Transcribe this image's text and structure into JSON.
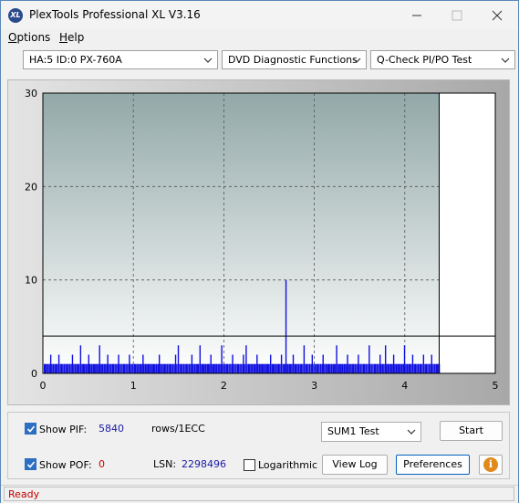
{
  "window": {
    "title": "PlexTools Professional XL V3.16",
    "app_icon_text": "XL"
  },
  "menu": {
    "items": [
      "Options",
      "Help"
    ]
  },
  "selectors": {
    "drive": "HA:5 ID:0  PX-760A",
    "function_group": "DVD Diagnostic Functions",
    "test": "Q-Check PI/PO Test"
  },
  "chart_data": {
    "type": "bar",
    "xlim": [
      0,
      5
    ],
    "ylim": [
      0,
      30
    ],
    "x_ticks": [
      "0",
      "1",
      "2",
      "3",
      "4",
      "5"
    ],
    "y_ticks": [
      "0",
      "10",
      "20",
      "30"
    ],
    "grid": true,
    "data_end_x": 4.38,
    "threshold_line": 4,
    "series": [
      {
        "color": "#1010e0",
        "description": "PI errors per position (approx. sample)",
        "x": [
          0.02,
          0.05,
          0.08,
          0.11,
          0.14,
          0.17,
          0.2,
          0.23,
          0.26,
          0.29,
          0.32,
          0.35,
          0.38,
          0.41,
          0.44,
          0.47,
          0.5,
          0.53,
          0.56,
          0.59,
          0.62,
          0.65,
          0.68,
          0.71,
          0.74,
          0.77,
          0.8,
          0.83,
          0.86,
          0.89,
          0.92,
          0.95,
          0.98,
          1.01,
          1.04,
          1.07,
          1.1,
          1.13,
          1.16,
          1.19,
          1.22,
          1.25,
          1.28,
          1.31,
          1.34,
          1.37,
          1.4,
          1.43,
          1.46,
          1.49,
          1.52,
          1.55,
          1.58,
          1.61,
          1.64,
          1.67,
          1.7,
          1.73,
          1.76,
          1.79,
          1.82,
          1.85,
          1.88,
          1.91,
          1.94,
          1.97,
          2.0,
          2.03,
          2.06,
          2.09,
          2.12,
          2.15,
          2.18,
          2.21,
          2.24,
          2.27,
          2.3,
          2.33,
          2.36,
          2.39,
          2.42,
          2.45,
          2.48,
          2.51,
          2.54,
          2.57,
          2.6,
          2.63,
          2.66,
          2.68,
          2.7,
          2.73,
          2.76,
          2.79,
          2.82,
          2.85,
          2.88,
          2.91,
          2.94,
          2.97,
          3.0,
          3.03,
          3.06,
          3.09,
          3.12,
          3.15,
          3.18,
          3.21,
          3.24,
          3.27,
          3.3,
          3.33,
          3.36,
          3.39,
          3.42,
          3.45,
          3.48,
          3.51,
          3.54,
          3.57,
          3.6,
          3.63,
          3.66,
          3.69,
          3.72,
          3.75,
          3.78,
          3.81,
          3.84,
          3.87,
          3.9,
          3.93,
          3.96,
          3.99,
          4.02,
          4.05,
          4.08,
          4.11,
          4.14,
          4.17,
          4.2,
          4.23,
          4.26,
          4.29,
          4.32,
          4.35
        ],
        "values": [
          1,
          1,
          2,
          1,
          1,
          2,
          1,
          1,
          1,
          1,
          2,
          1,
          1,
          3,
          1,
          1,
          2,
          1,
          1,
          1,
          3,
          1,
          1,
          2,
          1,
          1,
          1,
          2,
          1,
          1,
          1,
          2,
          1,
          1,
          1,
          1,
          2,
          1,
          1,
          1,
          1,
          1,
          2,
          1,
          1,
          1,
          1,
          1,
          2,
          3,
          1,
          1,
          1,
          1,
          2,
          1,
          1,
          3,
          1,
          1,
          1,
          2,
          1,
          1,
          1,
          3,
          1,
          1,
          1,
          2,
          1,
          1,
          1,
          2,
          3,
          1,
          1,
          1,
          2,
          1,
          1,
          1,
          1,
          2,
          1,
          1,
          1,
          2,
          1,
          10,
          1,
          1,
          2,
          1,
          1,
          1,
          3,
          1,
          1,
          2,
          1,
          1,
          1,
          2,
          1,
          1,
          1,
          1,
          3,
          1,
          1,
          1,
          2,
          1,
          1,
          1,
          2,
          1,
          1,
          1,
          3,
          1,
          1,
          1,
          2,
          1,
          3,
          1,
          1,
          2,
          1,
          1,
          1,
          3,
          1,
          1,
          2,
          1,
          1,
          1,
          2,
          1,
          1,
          2,
          1,
          1
        ]
      }
    ]
  },
  "controls": {
    "show_pif_label": "Show PIF:",
    "show_pif_checked": true,
    "pif_value": "5840",
    "pif_unit": "rows/1ECC",
    "show_pof_label": "Show POF:",
    "show_pof_checked": true,
    "pof_value": "0",
    "lsn_label": "LSN:",
    "lsn_value": "2298496",
    "logarithmic_label": "Logarithmic",
    "logarithmic_checked": false,
    "sum_test_selected": "SUM1 Test",
    "start_button": "Start",
    "view_log_button": "View Log",
    "preferences_button": "Preferences",
    "info_glyph": "i"
  },
  "status": {
    "text": "Ready"
  },
  "colors": {
    "bar": "#1010e0",
    "plot_bg_top": "#93a8a8",
    "plot_bg_bottom": "#ffffff",
    "status_text": "#c00000"
  }
}
